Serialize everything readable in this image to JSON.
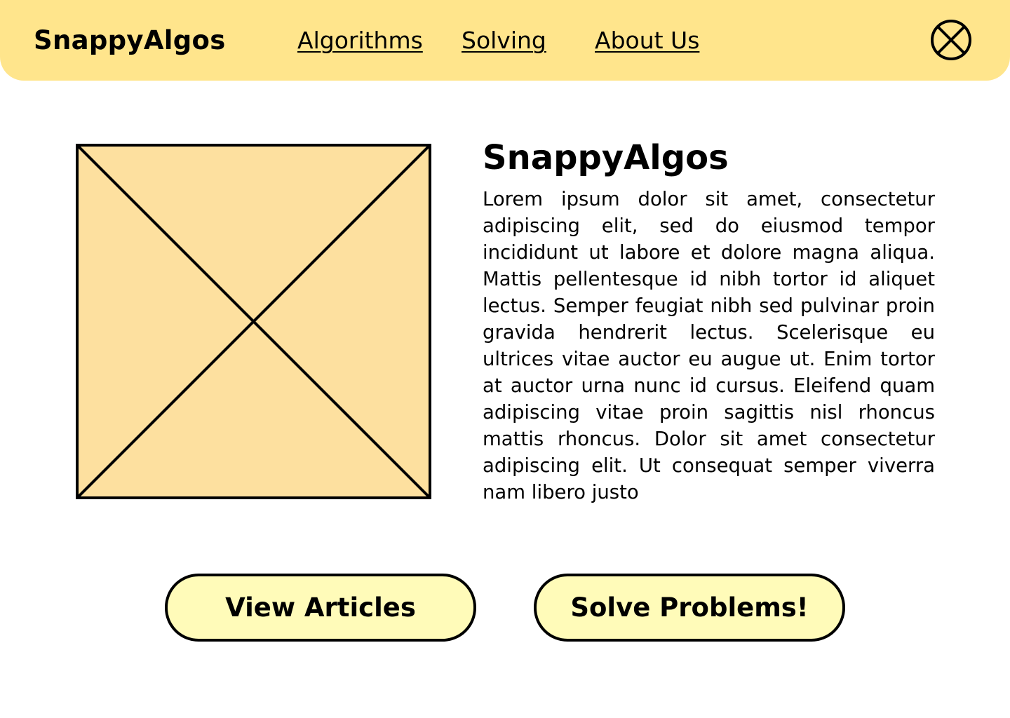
{
  "header": {
    "brand": "SnappyAlgos",
    "nav": {
      "algorithms": "Algorithms",
      "solving": "Solving",
      "about": "About Us"
    },
    "close_icon": "close-circle-x-icon"
  },
  "hero": {
    "image_placeholder_icon": "image-placeholder-icon",
    "title": "SnappyAlgos",
    "body": "Lorem ipsum dolor sit amet, consectetur adipiscing elit, sed do eiusmod tempor incididunt ut labore et dolore magna aliqua. Mattis pellentesque id nibh tortor id aliquet lectus. Semper feugiat nibh sed pulvinar proin gravida hendrerit lectus. Scelerisque eu ultrices vitae auctor eu augue ut. Enim tortor at auctor urna nunc id cursus. Eleifend quam adipiscing vitae proin sagittis nisl rhoncus mattis rhoncus. Dolor sit amet consectetur adipiscing elit. Ut consequat semper viverra nam libero justo"
  },
  "actions": {
    "view_articles": "View Articles",
    "solve_problems": "Solve Problems!"
  },
  "colors": {
    "header_bg": "#ffe58c",
    "placeholder_fill": "#fde09f",
    "button_bg": "#fffbb9"
  }
}
